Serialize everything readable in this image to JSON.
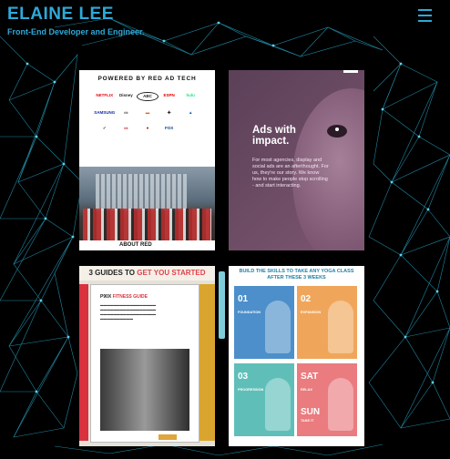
{
  "header": {
    "name": "ELAINE LEE",
    "tagline": "Front-End Developer and Engineer."
  },
  "menu": {
    "icon": "hamburger-menu-icon"
  },
  "colors": {
    "accent": "#2ea9d8",
    "background": "#000000"
  },
  "portfolio": [
    {
      "id": "red-ad-tech",
      "title": "POWERED BY RED AD TECH",
      "logos": [
        "NETFLIX",
        "Disney",
        "ABC",
        "ESPN",
        "hulu",
        "SAMSUNG",
        "",
        "",
        "",
        "",
        "",
        "",
        "",
        "",
        ""
      ],
      "caption": "ABOUT RED"
    },
    {
      "id": "ads-with-impact",
      "headline": "Ads with impact.",
      "body": "For most agencies, display and social ads are an afterthought. For us, they're our story. We know how to make people stop scrolling - and start interacting."
    },
    {
      "id": "p90x-guide",
      "title_prefix": "3 GUIDES TO",
      "title_highlight": "GET YOU STARTED",
      "guide_brand": "P90X",
      "guide_title": "FITNESS GUIDE"
    },
    {
      "id": "yoga-schedule",
      "title": "BUILD THE SKILLS TO TAKE ANY YOGA CLASS AFTER THESE 3 WEEKS",
      "tiles": [
        {
          "num": "01",
          "label": "FOUNDATION",
          "num2": "",
          "label2": ""
        },
        {
          "num": "02",
          "label": "EXPANSION",
          "num2": "",
          "label2": ""
        },
        {
          "num": "03",
          "label": "PROGRESSION",
          "num2": "",
          "label2": ""
        },
        {
          "num": "SAT",
          "label": "RELAX",
          "num2": "SUN",
          "label2": "TAKE IT"
        }
      ]
    }
  ]
}
